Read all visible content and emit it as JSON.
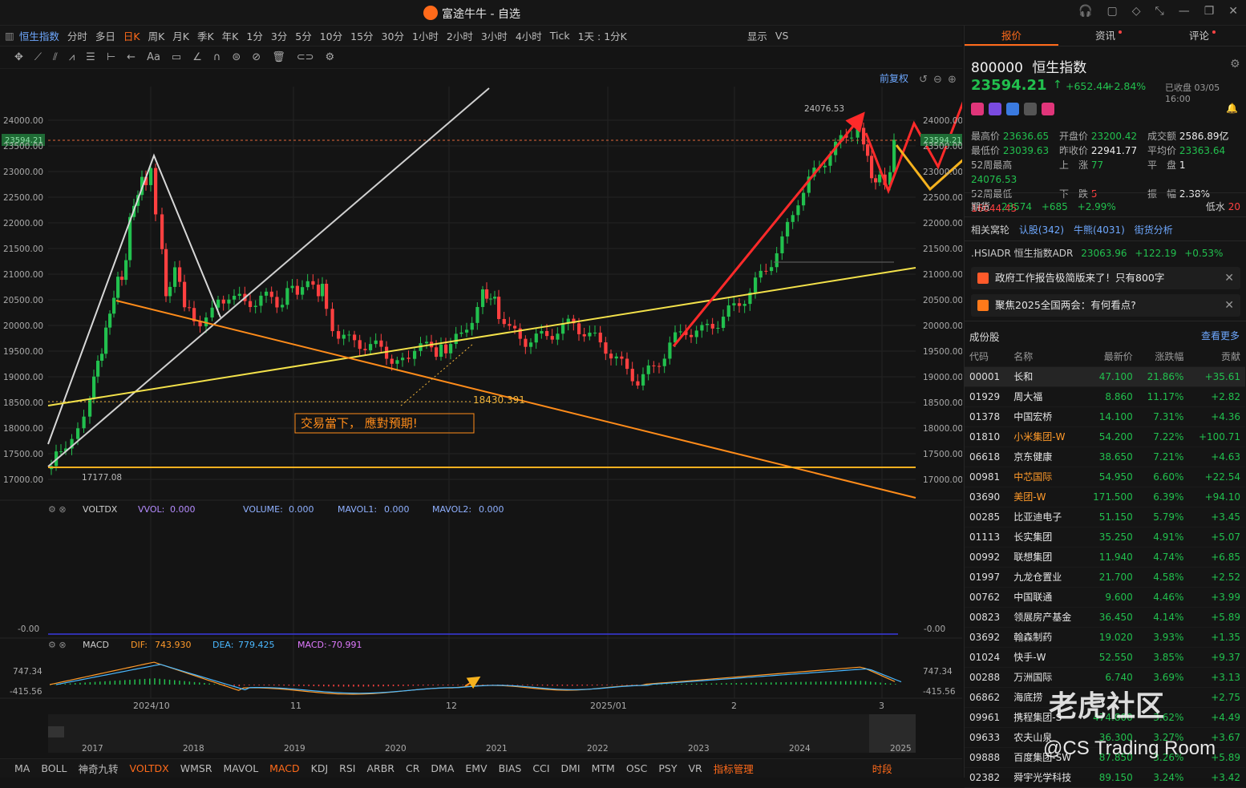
{
  "window": {
    "title": "富途牛牛 - 自选"
  },
  "toolbar": {
    "index_name": "恒生指数",
    "periods": [
      "分时",
      "多日",
      "日K",
      "周K",
      "月K",
      "季K",
      "年K",
      "1分",
      "3分",
      "5分",
      "10分",
      "15分",
      "30分",
      "1小时",
      "2小时",
      "3小时",
      "4小时",
      "Tick"
    ],
    "active_period": "日K",
    "range_label": "1天 : 1分K",
    "display_label": "显示",
    "vs_label": "VS"
  },
  "chart": {
    "restore_label": "前复权",
    "high_label": "24076.53",
    "low_label": "17177.08",
    "current_price_tag": "23594.21",
    "ref_price_label": "18430.391",
    "annotation_text": "交易當下， 應對預期!",
    "y_ticks": [
      "24000.00",
      "23500.00",
      "23000.00",
      "22500.00",
      "22000.00",
      "21500.00",
      "21000.00",
      "20500.00",
      "20000.00",
      "19500.00",
      "19000.00",
      "18500.00",
      "18000.00",
      "17500.00",
      "17000.00"
    ],
    "x_ticks": [
      "2024/10",
      "11",
      "12",
      "2025/01",
      "2",
      "3"
    ],
    "mini_years": [
      "2017",
      "2018",
      "2019",
      "2020",
      "2021",
      "2022",
      "2023",
      "2024",
      "2025"
    ],
    "colors": {
      "up": "#22c04e",
      "down": "#ff4040",
      "bg": "#141414",
      "orange": "#ff9a2a",
      "yellow": "#f3e14a"
    }
  },
  "voltdx": {
    "name": "VOLTDX",
    "vvol_label": "VVOL:",
    "vvol_value": "0.000",
    "volume_label": "VOLUME:",
    "volume_value": "0.000",
    "mavol1_label": "MAVOL1:",
    "mavol1_value": "0.000",
    "mavol2_label": "MAVOL2:",
    "mavol2_value": "0.000",
    "axis_zero": "-0.00"
  },
  "macd": {
    "name": "MACD",
    "dif_label": "DIF:",
    "dif_value": "743.930",
    "dea_label": "DEA:",
    "dea_value": "779.425",
    "macd_label": "MACD:",
    "macd_value": "-70.991",
    "axis_top": "747.34",
    "axis_bottom": "-415.56"
  },
  "indicators": [
    "MA",
    "BOLL",
    "神奇九转",
    "VOLTDX",
    "WMSR",
    "MAVOL",
    "MACD",
    "KDJ",
    "RSI",
    "ARBR",
    "CR",
    "DMA",
    "EMV",
    "BIAS",
    "CCI",
    "DMI",
    "MTM",
    "OSC",
    "PSY",
    "VR"
  ],
  "active_indicators": [
    "VOLTDX",
    "MACD"
  ],
  "indicator_manage": "指标管理",
  "time_share": "时段",
  "panel": {
    "tabs": [
      {
        "label": "报价"
      },
      {
        "label": "资讯"
      },
      {
        "label": "评论"
      }
    ],
    "code": "800000",
    "name": "恒生指数",
    "price": "23594.21",
    "change": "+652.44",
    "change_pct": "+2.84%",
    "status": "已收盘 03/05 16:00",
    "stats": {
      "high_label": "最高价",
      "high": "23636.65",
      "open_label": "开盘价",
      "open": "23200.42",
      "turnover_label": "成交额",
      "turnover": "2586.89亿",
      "low_label": "最低价",
      "low": "23039.63",
      "prev_label": "昨收价",
      "prev": "22941.77",
      "avg_label": "平均价",
      "avg": "23363.64",
      "w52h_label": "52周最高",
      "w52h": "24076.53",
      "up_label": "上　涨",
      "up": "77",
      "flat_label": "平　盘",
      "flat": "1",
      "w52l_label": "52周最低",
      "w52l": "16044.45",
      "down_label": "下　跌",
      "down": "5",
      "amp_label": "振　幅",
      "amp": "2.38%"
    },
    "futures_label": "期货",
    "futures_price": "23574",
    "futures_change": "+685",
    "futures_pct": "+2.99%",
    "discount_label": "低水",
    "discount_value": "20",
    "warrants_label": "相关窝轮",
    "calls": "认股(342)",
    "bulls": "牛熊(4031)",
    "street": "街货分析",
    "adr_label": ".HSIADR 恒生指数ADR",
    "adr_price": "23063.96",
    "adr_change": "+122.19",
    "adr_pct": "+0.53%",
    "news1": "政府工作报告极简版来了！只有800字",
    "news2": "聚焦2025全国两会：有何看点?",
    "constituents_label": "成份股",
    "see_more": "查看更多",
    "columns": [
      "代码",
      "名称",
      "最新价",
      "涨跌幅",
      "贡献"
    ],
    "rows": [
      [
        "00001",
        "长和",
        "47.100",
        "21.86%",
        "+35.61"
      ],
      [
        "01929",
        "周大福",
        "8.860",
        "11.17%",
        "+2.82"
      ],
      [
        "01378",
        "中国宏桥",
        "14.100",
        "7.31%",
        "+4.36"
      ],
      [
        "01810",
        "小米集团-W",
        "54.200",
        "7.22%",
        "+100.71"
      ],
      [
        "06618",
        "京东健康",
        "38.650",
        "7.21%",
        "+4.63"
      ],
      [
        "00981",
        "中芯国际",
        "54.950",
        "6.60%",
        "+22.54"
      ],
      [
        "03690",
        "美团-W",
        "171.500",
        "6.39%",
        "+94.10"
      ],
      [
        "00285",
        "比亚迪电子",
        "51.150",
        "5.79%",
        "+3.45"
      ],
      [
        "01113",
        "长实集团",
        "35.250",
        "4.91%",
        "+5.07"
      ],
      [
        "00992",
        "联想集团",
        "11.940",
        "4.74%",
        "+6.85"
      ],
      [
        "01997",
        "九龙仓置业",
        "21.700",
        "4.58%",
        "+2.52"
      ],
      [
        "00762",
        "中国联通",
        "9.600",
        "4.46%",
        "+3.99"
      ],
      [
        "00823",
        "领展房产基金",
        "36.450",
        "4.14%",
        "+5.89"
      ],
      [
        "03692",
        "翰森制药",
        "19.020",
        "3.93%",
        "+1.35"
      ],
      [
        "01024",
        "快手-W",
        "52.550",
        "3.85%",
        "+9.37"
      ],
      [
        "00288",
        "万洲国际",
        "6.740",
        "3.69%",
        "+3.13"
      ],
      [
        "06862",
        "海底捞",
        "",
        "",
        "+2.75"
      ],
      [
        "09961",
        "携程集团-S",
        "474.800",
        "3.62%",
        "+4.49"
      ],
      [
        "09633",
        "农夫山泉",
        "36.300",
        "3.27%",
        "+3.67"
      ],
      [
        "09888",
        "百度集团-SW",
        "87.850",
        "3.26%",
        "+5.89"
      ],
      [
        "02382",
        "舜宇光学科技",
        "89.150",
        "3.24%",
        "+3.42"
      ]
    ],
    "orange_names": [
      "小米集团-W",
      "中芯国际",
      "美团-W"
    ]
  },
  "watermark": {
    "cn": "老虎社区",
    "en": "@CS Trading Room"
  }
}
